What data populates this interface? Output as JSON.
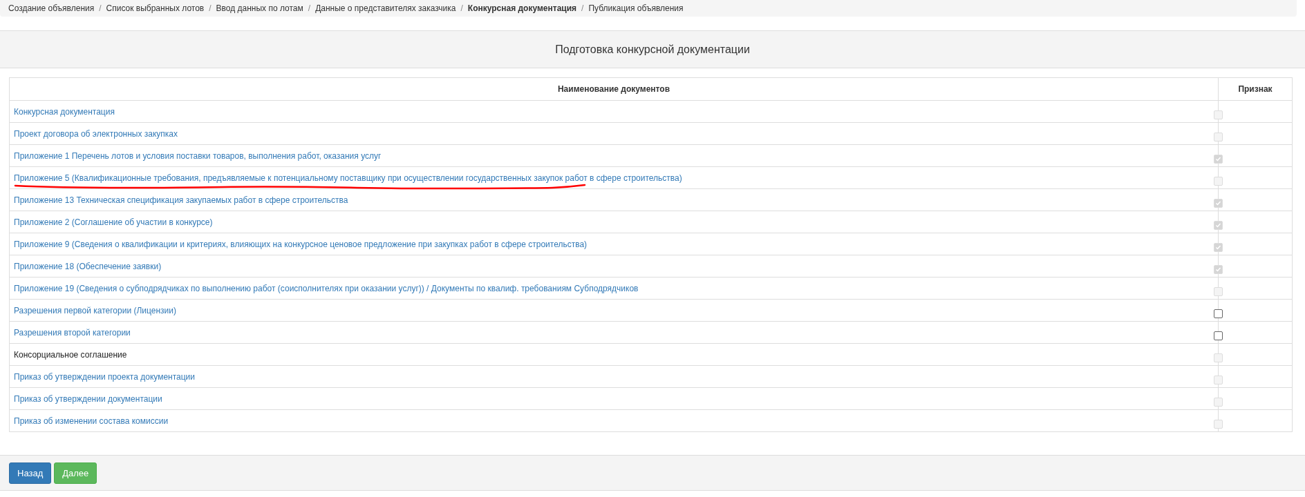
{
  "breadcrumb": [
    {
      "label": "Создание объявления",
      "current": false
    },
    {
      "label": "Список выбранных лотов",
      "current": false
    },
    {
      "label": "Ввод данных по лотам",
      "current": false
    },
    {
      "label": "Данные о представителях заказчика",
      "current": false
    },
    {
      "label": "Конкурсная документация",
      "current": true
    },
    {
      "label": "Публикация объявления",
      "current": false
    }
  ],
  "breadcrumb_separator": "/",
  "panel_title": "Подготовка конкурсной документации",
  "table": {
    "columns": [
      "Наименование документов",
      "Признак"
    ],
    "rows": [
      {
        "label": "Конкурсная документация",
        "kind": "link",
        "checked": false,
        "disabled": true
      },
      {
        "label": "Проект договора об электронных закупках",
        "kind": "link",
        "checked": false,
        "disabled": true
      },
      {
        "label": "Приложение 1 Перечень лотов и условия поставки товаров, выполнения работ, оказания услуг",
        "kind": "link",
        "checked": true,
        "disabled": true
      },
      {
        "label": "Приложение 5 (Квалификационные требования, предъявляемые к потенциальному поставщику при осуществлении государственных закупок работ в сфере строительства)",
        "kind": "link",
        "checked": false,
        "disabled": true,
        "marked_with_underline": true
      },
      {
        "label": "Приложение 13 Техническая спецификация закупаемых работ в сфере строительства",
        "kind": "link",
        "checked": true,
        "disabled": true
      },
      {
        "label": "Приложение 2 (Соглашение об участии в конкурсе)",
        "kind": "link",
        "checked": true,
        "disabled": true
      },
      {
        "label": "Приложение 9 (Сведения о квалификации и критериях, влияющих на конкурсное ценовое предложение при закупках работ в сфере строительства)",
        "kind": "link",
        "checked": true,
        "disabled": true
      },
      {
        "label": "Приложение 18 (Обеспечение заявки)",
        "kind": "link",
        "checked": true,
        "disabled": true
      },
      {
        "label": "Приложение 19 (Сведения о субподрядчиках по выполнению работ (соисполнителях при оказании услуг)) / Документы по квалиф. требованиям Субподрядчиков",
        "kind": "link",
        "checked": false,
        "disabled": true
      },
      {
        "label": "Разрешения первой категории (Лицензии)",
        "kind": "link",
        "checked": false,
        "disabled": false
      },
      {
        "label": "Разрешения второй категории",
        "kind": "link",
        "checked": false,
        "disabled": false
      },
      {
        "label": "Консорциальное соглашение",
        "kind": "text",
        "checked": false,
        "disabled": true
      },
      {
        "label": "Приказ об утверждении проекта документации",
        "kind": "link",
        "checked": false,
        "disabled": true
      },
      {
        "label": "Приказ об утверждении документации",
        "kind": "link",
        "checked": false,
        "disabled": true
      },
      {
        "label": "Приказ об изменении состава комиссии",
        "kind": "link",
        "checked": false,
        "disabled": true
      }
    ]
  },
  "buttons": [
    {
      "label": "Назад",
      "kind": "primary"
    },
    {
      "label": "Далее",
      "kind": "success"
    }
  ]
}
